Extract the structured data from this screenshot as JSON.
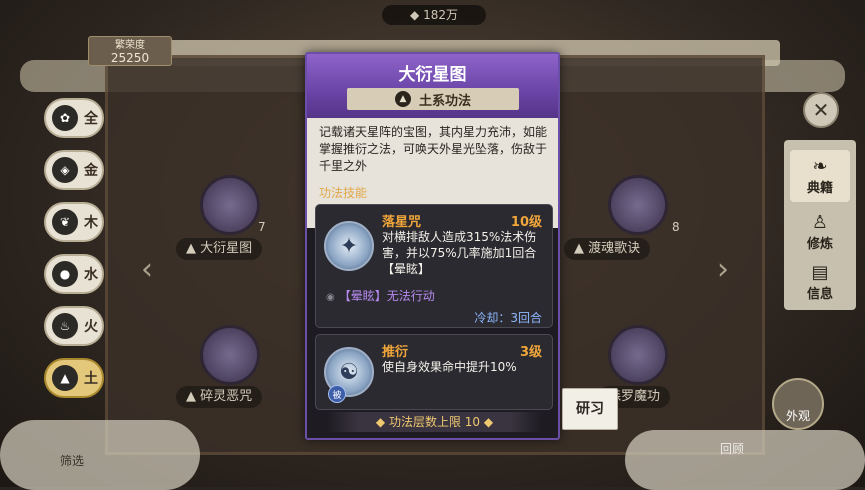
{
  "top": {
    "currency_value": "182万",
    "prosperity_label": "繁荣度",
    "prosperity_value": "25250"
  },
  "elements": [
    {
      "label": "全",
      "icon": "all-icon",
      "active": false
    },
    {
      "label": "金",
      "icon": "metal-icon",
      "active": false
    },
    {
      "label": "木",
      "icon": "wood-icon",
      "active": false
    },
    {
      "label": "水",
      "icon": "water-icon",
      "active": false
    },
    {
      "label": "火",
      "icon": "fire-icon",
      "active": false
    },
    {
      "label": "土",
      "icon": "earth-icon",
      "active": true
    }
  ],
  "cards": [
    {
      "name": "大衍星图",
      "count": "7"
    },
    {
      "name": "渡魂歌诀",
      "count": "8"
    },
    {
      "name": "碎灵恶咒",
      "count": ""
    },
    {
      "name": "森罗魔功",
      "count": ""
    }
  ],
  "side_tabs": [
    {
      "label": "典籍",
      "active": true
    },
    {
      "label": "修炼",
      "active": false
    },
    {
      "label": "信息",
      "active": false
    }
  ],
  "bottom": {
    "appearance_label": "外观",
    "back_label": "回顾",
    "filter_label": "筛选"
  },
  "popup": {
    "title": "大衍星图",
    "school": "土系功法",
    "description": "记载诸天星阵的宝图，其内星力充沛，如能掌握推衍之法，可唤天外星光坠落，伤敌于千里之外",
    "skills_title": "功法技能",
    "skills": [
      {
        "name": "落星咒",
        "level": "10级",
        "text": "对横排敌人造成315%法术伤害，并以75%几率施加1回合【晕眩】",
        "status": "【晕眩】无法行动",
        "cooldown": "冷却：3回合"
      },
      {
        "name": "推衍",
        "level": "3级",
        "text": "使自身效果命中提升10%",
        "badge": "被"
      }
    ],
    "layer_limit": "功法层数上限 10",
    "study_button": "研习"
  },
  "colors": {
    "accent_purple": "#6b4ea8",
    "skill_orange": "#f0a63a",
    "status_purple": "#b78af0",
    "cooldown_blue": "#8fb8ff"
  }
}
